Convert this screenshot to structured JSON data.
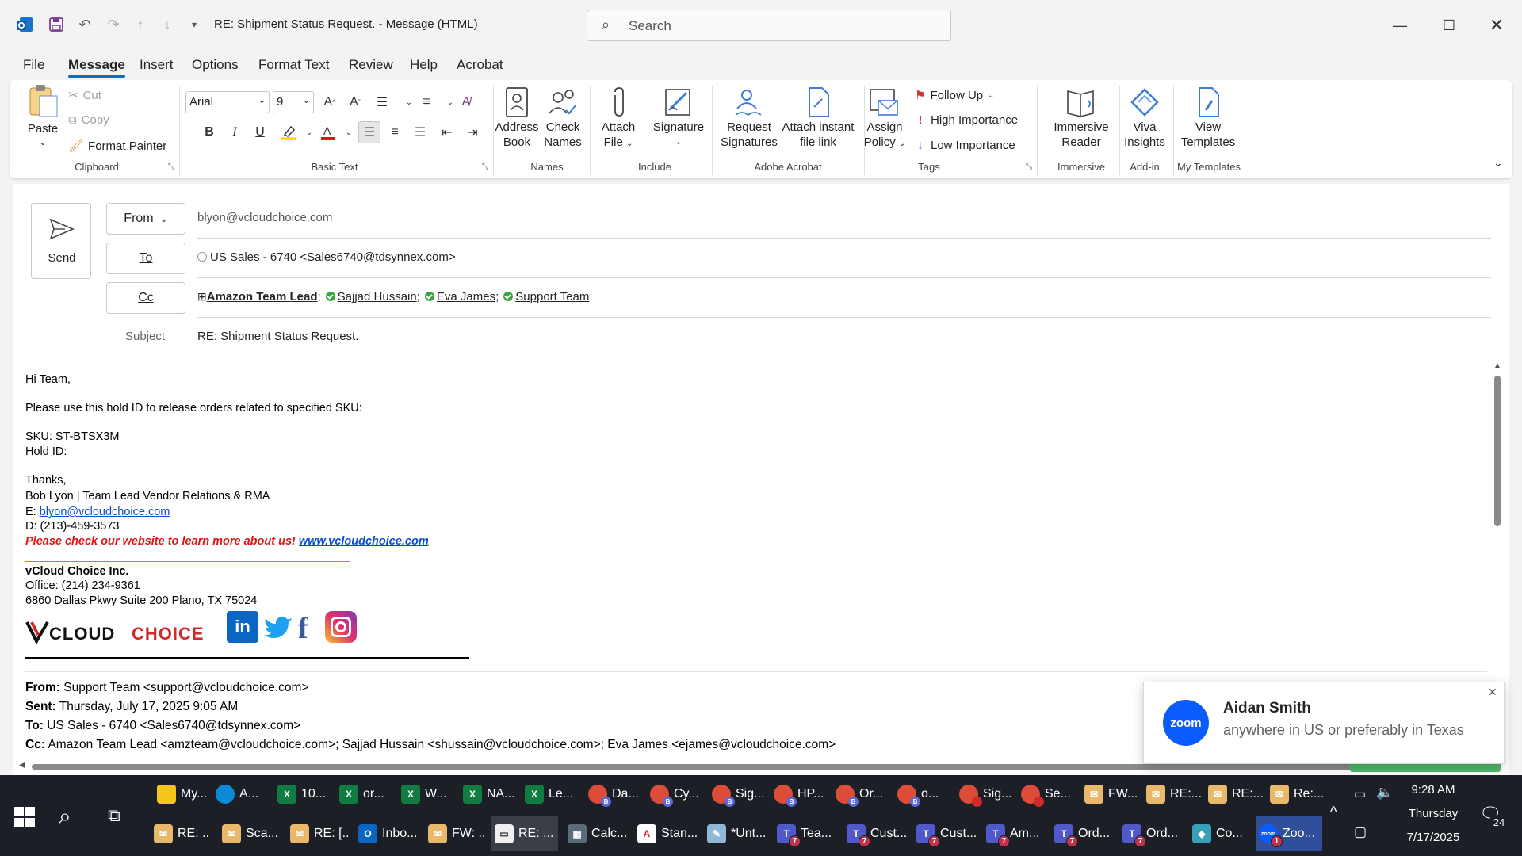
{
  "titlebar": {
    "title": "RE: Shipment Status Request.  -  Message (HTML)",
    "search_placeholder": "Search"
  },
  "menu": [
    "File",
    "Message",
    "Insert",
    "Options",
    "Format Text",
    "Review",
    "Help",
    "Acrobat"
  ],
  "ribbon": {
    "clipboard": {
      "paste": "Paste",
      "cut": "Cut",
      "copy": "Copy",
      "format_painter": "Format Painter",
      "group": "Clipboard"
    },
    "basic_text": {
      "font": "Arial",
      "size": "9",
      "group": "Basic Text"
    },
    "names": {
      "address_book": [
        "Address",
        "Book"
      ],
      "check_names": [
        "Check",
        "Names"
      ],
      "group": "Names"
    },
    "include": {
      "attach_file": [
        "Attach",
        "File"
      ],
      "signature": "Signature",
      "group": "Include"
    },
    "adobe": {
      "request_signatures": [
        "Request",
        "Signatures"
      ],
      "attach_link": [
        "Attach instant",
        "file link"
      ],
      "group": "Adobe Acrobat"
    },
    "tags": {
      "assign_policy": [
        "Assign",
        "Policy"
      ],
      "follow_up": "Follow Up",
      "high": "High Importance",
      "low": "Low Importance",
      "group": "Tags"
    },
    "immersive": {
      "reader": [
        "Immersive",
        "Reader"
      ],
      "group": "Immersive"
    },
    "addin": {
      "viva": [
        "Viva",
        "Insights"
      ],
      "group": "Add-in"
    },
    "templates": {
      "view": [
        "View",
        "Templates"
      ],
      "group": "My Templates"
    }
  },
  "compose": {
    "send": "Send",
    "from_label": "From",
    "from_value": "blyon@vcloudchoice.com",
    "to_label": "To",
    "to_value": "US Sales - 6740 <Sales6740@tdsynnex.com>",
    "cc_label": "Cc",
    "cc": [
      "Amazon Team Lead",
      "Sajjad Hussain",
      "Eva James",
      "Support Team"
    ],
    "subject_label": "Subject",
    "subject_value": "RE: Shipment Status Request."
  },
  "body": {
    "greeting": "Hi Team,",
    "line1": "Please use this hold ID to release orders related to specified SKU:",
    "sku": "SKU: ST-BTSX3M",
    "hold": "Hold ID:",
    "thanks": "Thanks,",
    "sig_name": "Bob Lyon | Team Lead Vendor Relations & RMA",
    "sig_email_label": "E:",
    "sig_email": "blyon@vcloudchoice.com",
    "sig_phone": "D: (213)-459-3573",
    "promo": "Please check our website to learn more about us!",
    "website": "www.vcloudchoice.com",
    "company": "vCloud Choice Inc.",
    "office": "Office: (214) 234-9361",
    "address": "6860 Dallas Pkwy Suite 200 Plano, TX 75024",
    "logo_text": "VCLOUDCHOICE",
    "quoted": {
      "from_label": "From:",
      "from": "Support Team <support@vcloudchoice.com>",
      "sent_label": "Sent:",
      "sent": "Thursday, July 17, 2025 9:05 AM",
      "to_label": "To:",
      "to": "US Sales - 6740 <Sales6740@tdsynnex.com>",
      "cc_label": "Cc:",
      "cc": "Amazon Team Lead <amzteam@vcloudchoice.com>; Sajjad Hussain <shussain@vcloudchoice.com>; Eva James <ejames@vcloudchoice.com>"
    }
  },
  "toast": {
    "app": "zoom",
    "name": "Aidan Smith",
    "message": "anywhere in US or preferably in Texas"
  },
  "taskbar": {
    "row1": [
      "My...",
      "A...",
      "10...",
      "or...",
      "W...",
      "NA...",
      "Le...",
      "Da...",
      "Cy...",
      "Sig...",
      "HP...",
      "Or...",
      "o...",
      "Sig...",
      "Se...",
      "FW...",
      "RE:...",
      "RE:...",
      "Re:..."
    ],
    "row2": [
      "RE: ...",
      "Sca...",
      "RE: [...",
      "Inbo...",
      "FW: ...",
      "RE: ...",
      "Calc...",
      "Stan...",
      "*Unt...",
      "Tea...",
      "Cust...",
      "Cust...",
      "Am...",
      "Ord...",
      "Ord...",
      "Co...",
      "Zoo..."
    ],
    "time": "9:28 AM",
    "day": "Thursday",
    "date": "7/17/2025",
    "notif_count": "24",
    "teams_badge": "7",
    "zoom_badge": "1"
  }
}
